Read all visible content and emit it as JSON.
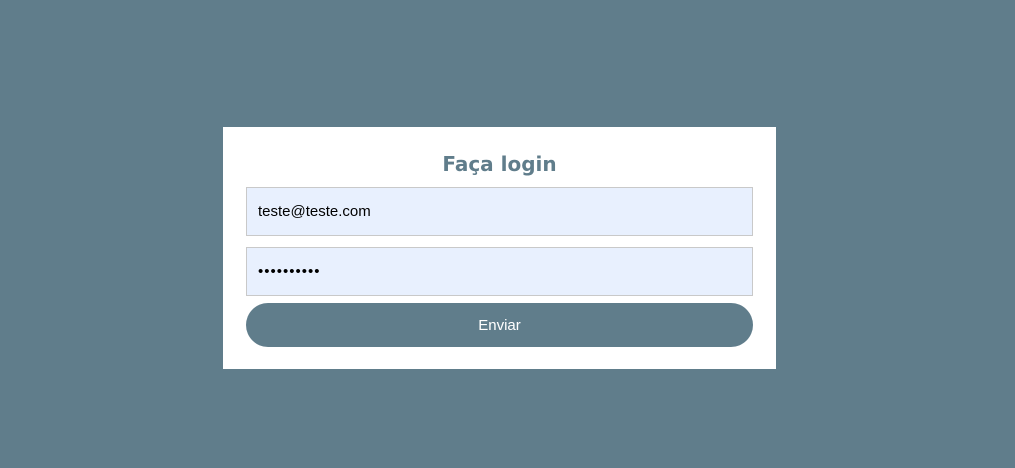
{
  "colors": {
    "background": "#607d8b",
    "card": "#ffffff",
    "accent": "#607d8b",
    "input_fill": "#e8f0fe"
  },
  "login_form": {
    "title": "Faça login",
    "email_value": "teste@teste.com",
    "password_value": "••••••••••",
    "submit_label": "Enviar"
  }
}
